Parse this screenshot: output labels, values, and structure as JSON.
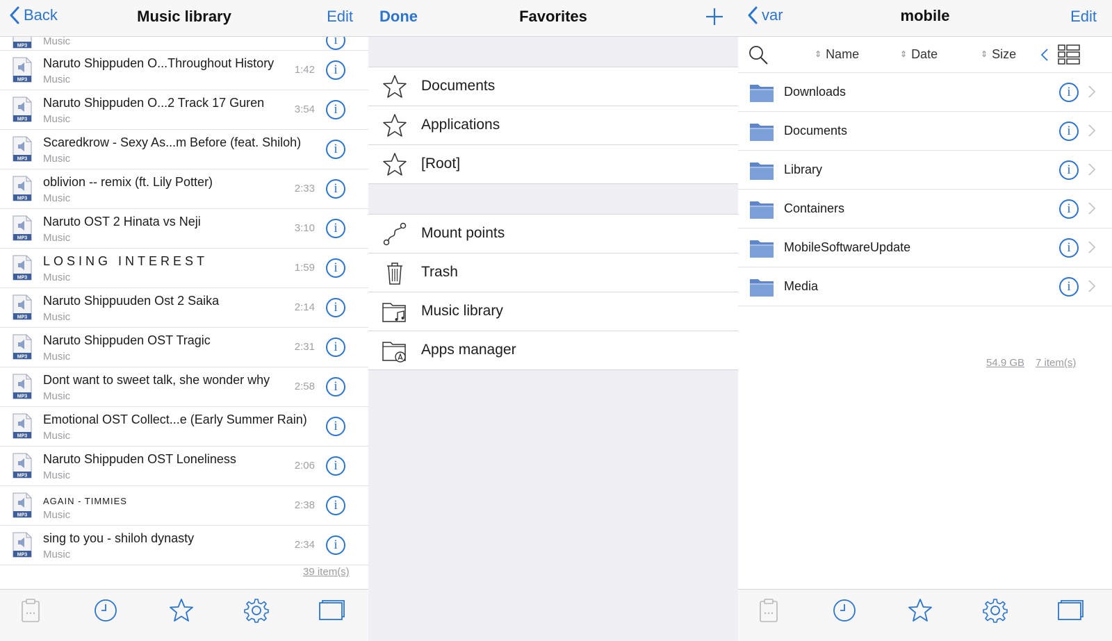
{
  "music": {
    "nav": {
      "back": "Back",
      "title": "Music library",
      "edit": "Edit"
    },
    "partial_row": {
      "sub": "Music"
    },
    "songs": [
      {
        "title": "Naruto Shippuden O...Throughout History",
        "sub": "Music",
        "dur": "1:42",
        "style": "normal"
      },
      {
        "title": "Naruto Shippuden O...2   Track 17   Guren",
        "sub": "Music",
        "dur": "3:54",
        "style": "normal"
      },
      {
        "title": "Scaredkrow - Sexy As...m Before (feat. Shiloh)",
        "sub": "Music",
        "dur": "",
        "style": "normal"
      },
      {
        "title": "oblivion -- remix (ft. Lily Potter)",
        "sub": "Music",
        "dur": "2:33",
        "style": "normal"
      },
      {
        "title": "Naruto OST 2   Hinata vs Neji",
        "sub": "Music",
        "dur": "3:10",
        "style": "normal"
      },
      {
        "title": "LOSING INTEREST",
        "sub": "Music",
        "dur": "1:59",
        "style": "spaced"
      },
      {
        "title": "Naruto Shippuuden Ost 2   Saika",
        "sub": "Music",
        "dur": "2:14",
        "style": "normal"
      },
      {
        "title": "Naruto Shippuden OST   Tragic",
        "sub": "Music",
        "dur": "2:31",
        "style": "normal"
      },
      {
        "title": "Dont want to sweet talk, she wonder why",
        "sub": "Music",
        "dur": "2:58",
        "style": "normal"
      },
      {
        "title": "Emotional OST Collect...e (Early Summer Rain)",
        "sub": "Music",
        "dur": "",
        "style": "normal"
      },
      {
        "title": "Naruto Shippuden OST   Loneliness",
        "sub": "Music",
        "dur": "2:06",
        "style": "normal"
      },
      {
        "title": "again - timmies",
        "sub": "Music",
        "dur": "2:38",
        "style": "smallcaps"
      },
      {
        "title": "sing to you - shiloh dynasty",
        "sub": "Music",
        "dur": "2:34",
        "style": "normal"
      }
    ],
    "count": "39 item(s)"
  },
  "favorites": {
    "nav": {
      "done": "Done",
      "title": "Favorites"
    },
    "group1": [
      {
        "label": "Documents",
        "icon": "star-icon"
      },
      {
        "label": "Applications",
        "icon": "star-icon"
      },
      {
        "label": "[Root]",
        "icon": "star-icon"
      }
    ],
    "group2": [
      {
        "label": "Mount points",
        "icon": "mount-points-icon"
      },
      {
        "label": "Trash",
        "icon": "trash-icon"
      },
      {
        "label": "Music library",
        "icon": "music-folder-icon"
      },
      {
        "label": "Apps manager",
        "icon": "apps-folder-icon"
      }
    ]
  },
  "files": {
    "nav": {
      "back": "var",
      "title": "mobile",
      "edit": "Edit"
    },
    "sort": {
      "name": "Name",
      "date": "Date",
      "size": "Size"
    },
    "folders": [
      {
        "name": "Downloads"
      },
      {
        "name": "Documents"
      },
      {
        "name": "Library"
      },
      {
        "name": "Containers"
      },
      {
        "name": "MobileSoftwareUpdate"
      },
      {
        "name": "Media"
      }
    ],
    "free_space": "54.9 GB",
    "count": "7 item(s)"
  },
  "colors": {
    "accent": "#2b74cf",
    "folder": "#7a9fd9",
    "muted": "#9b9ba0"
  },
  "toolbar_icons": [
    "clipboard-icon",
    "clock-icon",
    "star-icon",
    "gear-icon",
    "windows-icon"
  ]
}
